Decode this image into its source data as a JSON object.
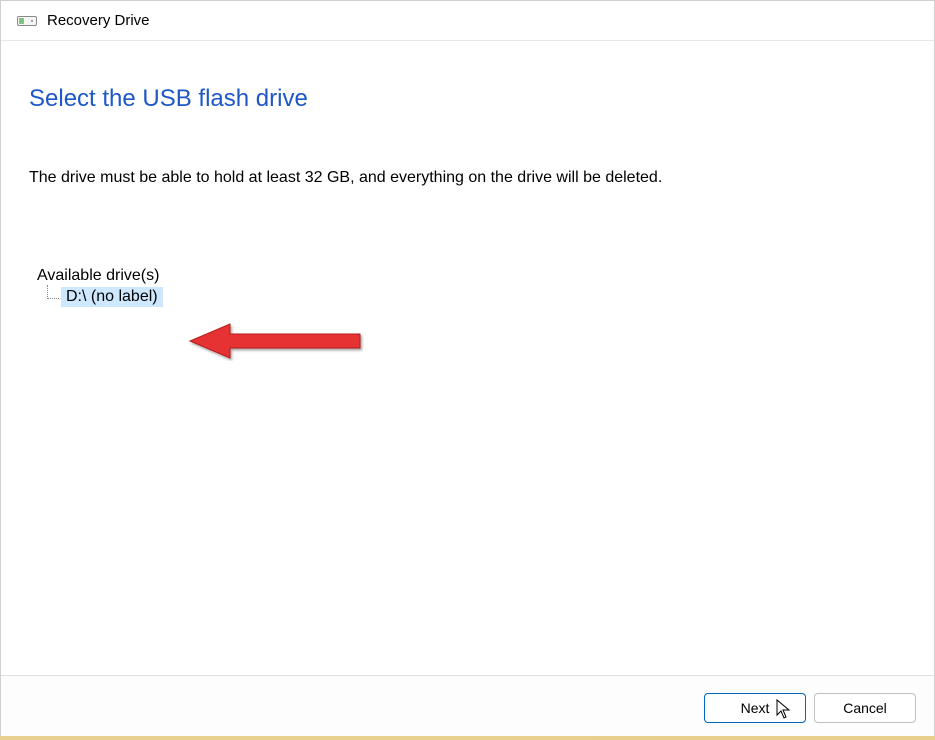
{
  "titlebar": {
    "title": "Recovery Drive",
    "icon": "drive-icon"
  },
  "main": {
    "heading": "Select the USB flash drive",
    "description": "The drive must be able to hold at least 32 GB, and everything on the drive will be deleted."
  },
  "drives": {
    "label": "Available drive(s)",
    "items": [
      {
        "name": "D:\\ (no label)",
        "selected": true
      }
    ]
  },
  "footer": {
    "next_label": "Next",
    "cancel_label": "Cancel"
  }
}
